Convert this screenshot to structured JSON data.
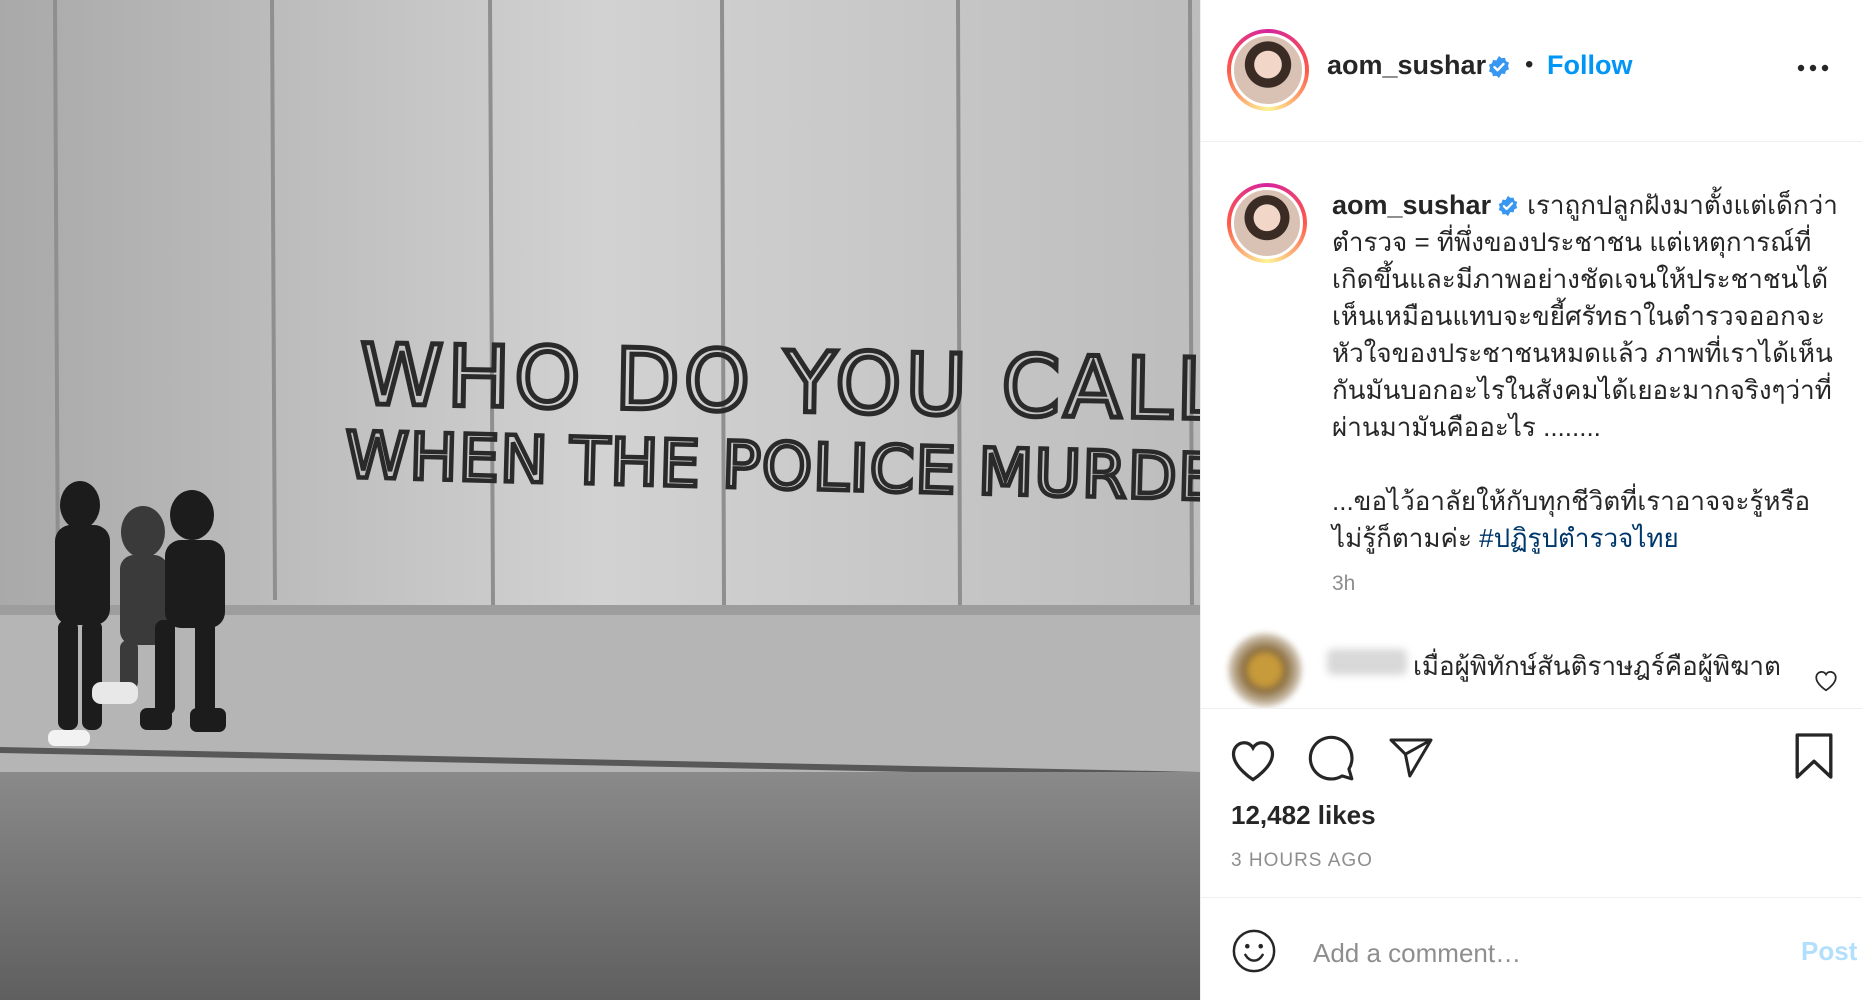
{
  "header": {
    "username": "aom_sushar",
    "separator": "•",
    "follow_label": "Follow"
  },
  "graffiti": {
    "line1": "WHO DO YOU CALL",
    "line2": "WHEN THE POLICE MURDERS?"
  },
  "caption": {
    "username": "aom_sushar",
    "text": "เราถูกปลูกฝังมาตั้งแต่เด็กว่าตำรวจ = ที่พึ่งของประชาชน แต่เหตุการณ์ที่เกิดขึ้นและมีภาพอย่างชัดเจนให้ประชาชนได้เห็นเหมือนแทบจะขยี้ศรัทธาในตำรวจออกจะหัวใจของประชาชนหมดแล้ว ภาพที่เราได้เห็นกันมันบอกอะไรในสังคมได้เยอะมากจริงๆว่าที่ผ่านมามันคืออะไร ........",
    "text2": "...ขอไว้อาลัยให้กับทุกชีวิตที่เราอาจจะรู้หรือไม่รู้ก็ตามค่ะ ",
    "hashtag": "#ปฏิรูปตำรวจไทย",
    "time": "3h"
  },
  "comment": {
    "username": "mwy",
    "text": "เมื่อผู้พิทักษ์สันติราษฎร์คือผู้พิฆาต"
  },
  "stats": {
    "likes": "12,482 likes",
    "time_ago": "3 HOURS AGO"
  },
  "comment_box": {
    "placeholder": "Add a comment…",
    "post_label": "Post"
  },
  "icons": {
    "verified": "verified-badge-icon",
    "more": "more-options-icon",
    "like": "heart-icon",
    "comment": "comment-bubble-icon",
    "share": "paper-plane-icon",
    "save": "bookmark-icon",
    "emoji": "emoji-smile-icon"
  },
  "colors": {
    "link_blue": "#0095f6",
    "verified_blue": "#3897f0",
    "hashtag_blue": "#00376b",
    "muted_gray": "#8e8e8e",
    "post_disabled": "#b2dffc"
  }
}
